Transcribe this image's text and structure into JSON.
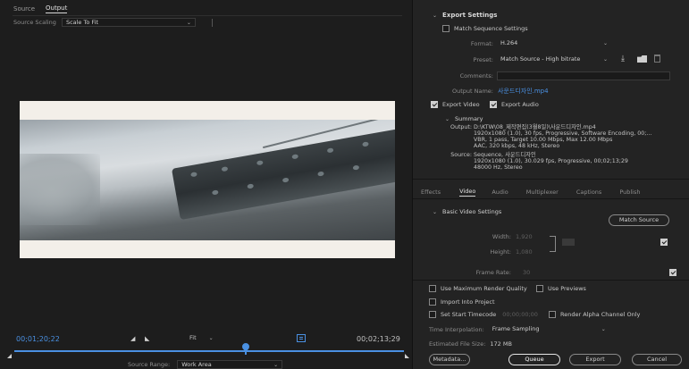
{
  "left": {
    "tabs": [
      "Source",
      "Output"
    ],
    "source_scaling_label": "Source Scaling",
    "source_scaling_value": "Scale To Fit",
    "timecode_current": "00;01;20;22",
    "zoom_value": "Fit",
    "timecode_duration": "00;02;13;29",
    "source_range_label": "Source Range:",
    "source_range_value": "Work Area"
  },
  "export": {
    "section_title": "Export Settings",
    "match_sequence_label": "Match Sequence Settings",
    "format_label": "Format:",
    "format_value": "H.264",
    "preset_label": "Preset:",
    "preset_value": "Match Source - High bitrate",
    "comments_label": "Comments:",
    "output_name_label": "Output Name:",
    "output_name_value": "사운드디자인.mp4",
    "export_video_label": "Export Video",
    "export_audio_label": "Export Audio",
    "summary_title": "Summary",
    "summary_output_label": "Output:",
    "summary_output_lines": [
      "D:\\KTW\\08_제작편집(3월8일)\\사운드디자인.mp4",
      "1920x1080 (1.0), 30 fps, Progressive, Software Encoding, 00;...",
      "VBR, 1 pass, Target 10.00 Mbps, Max 12.00 Mbps",
      "AAC, 320 kbps, 48 kHz, Stereo"
    ],
    "summary_source_label": "Source:",
    "summary_source_lines": [
      "Sequence, 사운드디자인",
      "1920x1080 (1.0), 30.029 fps, Progressive, 00;02;13;29",
      "48000 Hz, Stereo"
    ]
  },
  "settings_tabs": [
    "Effects",
    "Video",
    "Audio",
    "Multiplexer",
    "Captions",
    "Publish"
  ],
  "video": {
    "section_title": "Basic Video Settings",
    "match_source_label": "Match Source",
    "width_label": "Width:",
    "width_value": "1,920",
    "height_label": "Height:",
    "height_value": "1,080",
    "frame_rate_label": "Frame Rate:",
    "frame_rate_value": "30"
  },
  "bottom": {
    "max_render_label": "Use Maximum Render Quality",
    "use_previews_label": "Use Previews",
    "import_project_label": "Import Into Project",
    "set_start_tc_label": "Set Start Timecode",
    "start_tc_value": "00;00;00;00",
    "render_alpha_label": "Render Alpha Channel Only",
    "time_interp_label": "Time Interpolation:",
    "time_interp_value": "Frame Sampling",
    "est_size_label": "Estimated File Size:",
    "est_size_value": "172 MB",
    "metadata_label": "Metadata...",
    "queue_label": "Queue",
    "export_label": "Export",
    "cancel_label": "Cancel"
  },
  "colors": {
    "accent_blue": "#4a90e2",
    "playhead": "#4a90e2"
  }
}
